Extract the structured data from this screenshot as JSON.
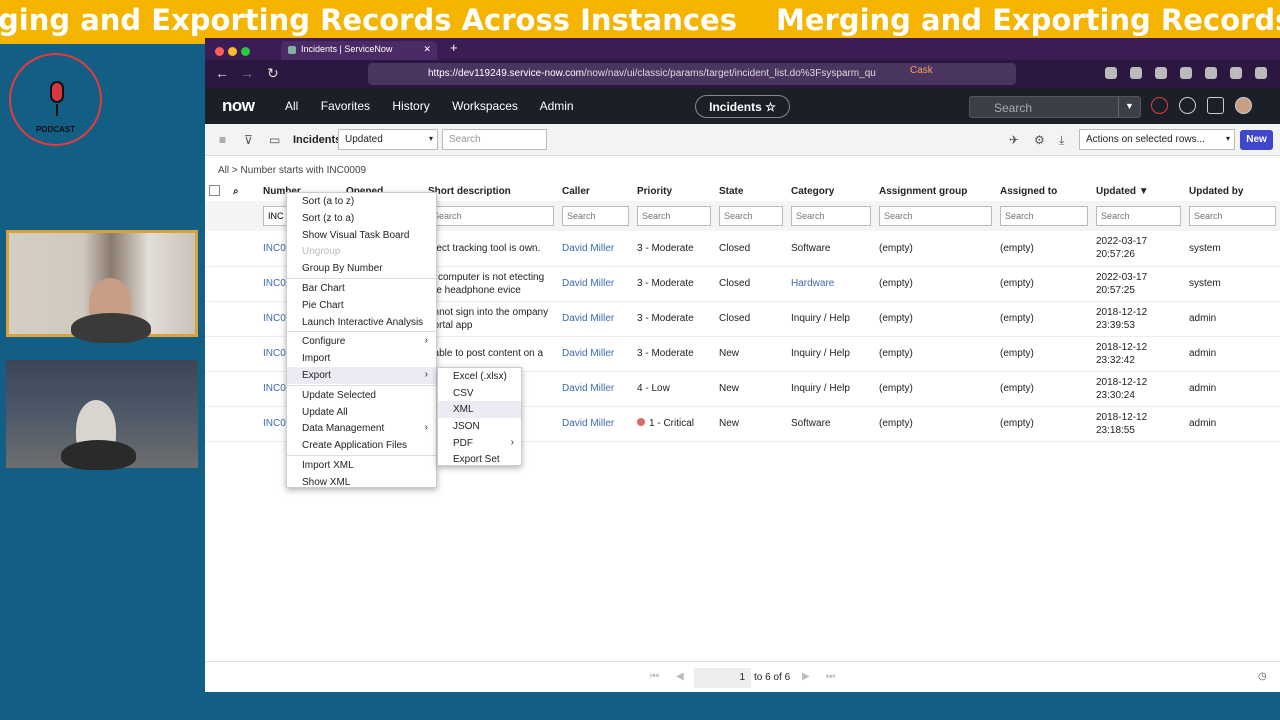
{
  "banner": {
    "text_left": "ging and Exporting Records Across Instances",
    "text_right": "Merging and Exporting Records Acr"
  },
  "podcast_logo": {
    "label": "PODCAST"
  },
  "browser": {
    "tab_title": "Incidents | ServiceNow",
    "url_host": "https://dev119249.service-now.com",
    "url_path": "/now/nav/ui/classic/params/target/incident_list.do%3Fsysparm_qu",
    "cask_label": "Cask"
  },
  "header": {
    "logo": "now",
    "nav": [
      "All",
      "Favorites",
      "History",
      "Workspaces",
      "Admin"
    ],
    "context_pill": "Incidents ☆",
    "search_placeholder": "Search"
  },
  "toolbar": {
    "list_title": "Incidents",
    "filter_field": "Updated",
    "search_placeholder": "Search",
    "actions_select": "Actions on selected rows...",
    "new_button": "New"
  },
  "breadcrumb": "All  >  Number starts with INC0009",
  "table": {
    "columns": [
      "Number",
      "Opened",
      "Short description",
      "Caller",
      "Priority",
      "State",
      "Category",
      "Assignment group",
      "Assigned to",
      "Updated ▼",
      "Updated by"
    ],
    "number_filter_value": "INC",
    "search_placeholder": "Search",
    "rows": [
      {
        "number": "INC0",
        "desc": "efect tracking tool is own.",
        "caller": "David Miller",
        "priority": "3 - Moderate",
        "state": "Closed",
        "category": "Software",
        "group": "(empty)",
        "assigned": "(empty)",
        "updated": "2022-03-17 20:57:26",
        "updated_by": "system"
      },
      {
        "number": "INC0",
        "desc": "ly computer is not etecting the headphone evice",
        "caller": "David Miller",
        "priority": "3 - Moderate",
        "state": "Closed",
        "category": "Hardware",
        "group": "(empty)",
        "assigned": "(empty)",
        "updated": "2022-03-17 20:57:25",
        "updated_by": "system"
      },
      {
        "number": "INC0",
        "desc": "annot sign into the ompany portal app",
        "caller": "David Miller",
        "priority": "3 - Moderate",
        "state": "Closed",
        "category": "Inquiry / Help",
        "group": "(empty)",
        "assigned": "(empty)",
        "updated": "2018-12-12 23:39:53",
        "updated_by": "admin"
      },
      {
        "number": "INC0",
        "desc": "nable to post content on a",
        "caller": "David Miller",
        "priority": "3 - Moderate",
        "state": "New",
        "category": "Inquiry / Help",
        "group": "(empty)",
        "assigned": "(empty)",
        "updated": "2018-12-12 23:32:42",
        "updated_by": "admin"
      },
      {
        "number": "INC0",
        "desc": "",
        "caller": "David Miller",
        "priority": "4 - Low",
        "state": "New",
        "category": "Inquiry / Help",
        "group": "(empty)",
        "assigned": "(empty)",
        "updated": "2018-12-12 23:30:24",
        "updated_by": "admin"
      },
      {
        "number": "INC0",
        "desc": "",
        "caller": "David Miller",
        "priority": "1 - Critical",
        "state": "New",
        "category": "Software",
        "group": "(empty)",
        "assigned": "(empty)",
        "updated": "2018-12-12 23:18:55",
        "updated_by": "admin"
      }
    ]
  },
  "context_menu": {
    "items": [
      "Sort (a to z)",
      "Sort (z to a)",
      "Show Visual Task Board",
      "Ungroup",
      "Group By Number",
      "Bar Chart",
      "Pie Chart",
      "Launch Interactive Analysis",
      "Configure",
      "Import",
      "Export",
      "Update Selected",
      "Update All",
      "Data Management",
      "Create Application Files",
      "Import XML",
      "Show XML"
    ]
  },
  "export_submenu": {
    "items": [
      "Excel (.xlsx)",
      "CSV",
      "XML",
      "JSON",
      "PDF",
      "Export Set"
    ]
  },
  "pager": {
    "page": "1",
    "range": "to 6 of 6"
  }
}
